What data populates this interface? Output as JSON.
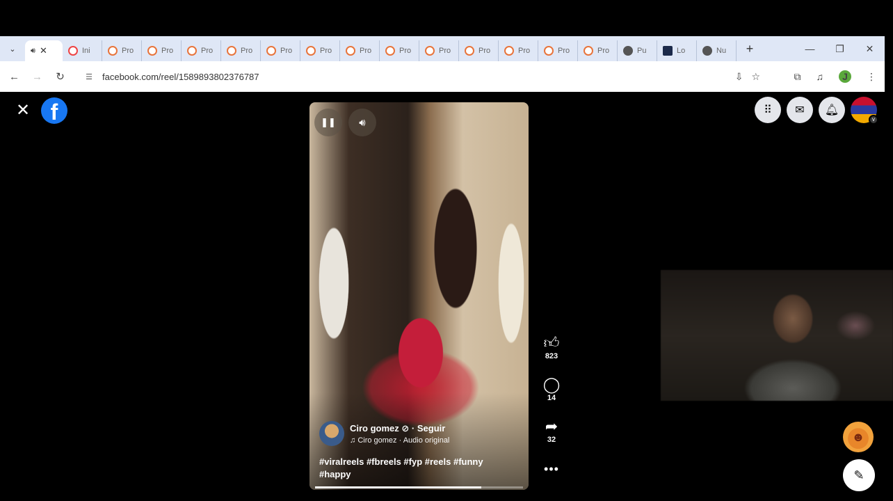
{
  "browser": {
    "tabs": [
      {
        "label": "",
        "favicon": "speaker",
        "active": true
      },
      {
        "label": "Ini",
        "favicon": "red-circle"
      },
      {
        "label": "Pro",
        "favicon": "orange-circle"
      },
      {
        "label": "Pro",
        "favicon": "orange-circle"
      },
      {
        "label": "Pro",
        "favicon": "orange-circle"
      },
      {
        "label": "Pro",
        "favicon": "orange-circle"
      },
      {
        "label": "Pro",
        "favicon": "orange-circle"
      },
      {
        "label": "Pro",
        "favicon": "orange-circle"
      },
      {
        "label": "Pro",
        "favicon": "orange-circle"
      },
      {
        "label": "Pro",
        "favicon": "orange-circle"
      },
      {
        "label": "Pro",
        "favicon": "orange-circle"
      },
      {
        "label": "Pro",
        "favicon": "orange-circle"
      },
      {
        "label": "Pro",
        "favicon": "orange-circle"
      },
      {
        "label": "Pro",
        "favicon": "orange-circle"
      },
      {
        "label": "Pro",
        "favicon": "orange-circle"
      },
      {
        "label": "Pu",
        "favicon": "gray-circle"
      },
      {
        "label": "Lo",
        "favicon": "dark-square"
      },
      {
        "label": "Nu",
        "favicon": "chrome"
      }
    ],
    "url": "facebook.com/reel/1589893802376787",
    "profile_initial": "J"
  },
  "reel": {
    "author": "Ciro gomez",
    "follow_label": "Seguir",
    "audio": "Ciro gomez · Audio original",
    "hashtags_line1": "#viralreels #fbreels #fyp #reels #funny",
    "hashtags_line2": "#happy",
    "progress": 0.8,
    "likes": "823",
    "comments": "14",
    "shares": "32"
  },
  "colors": {
    "fb_blue": "#1877f2",
    "tabstrip_bg": "#dfe7f6"
  }
}
